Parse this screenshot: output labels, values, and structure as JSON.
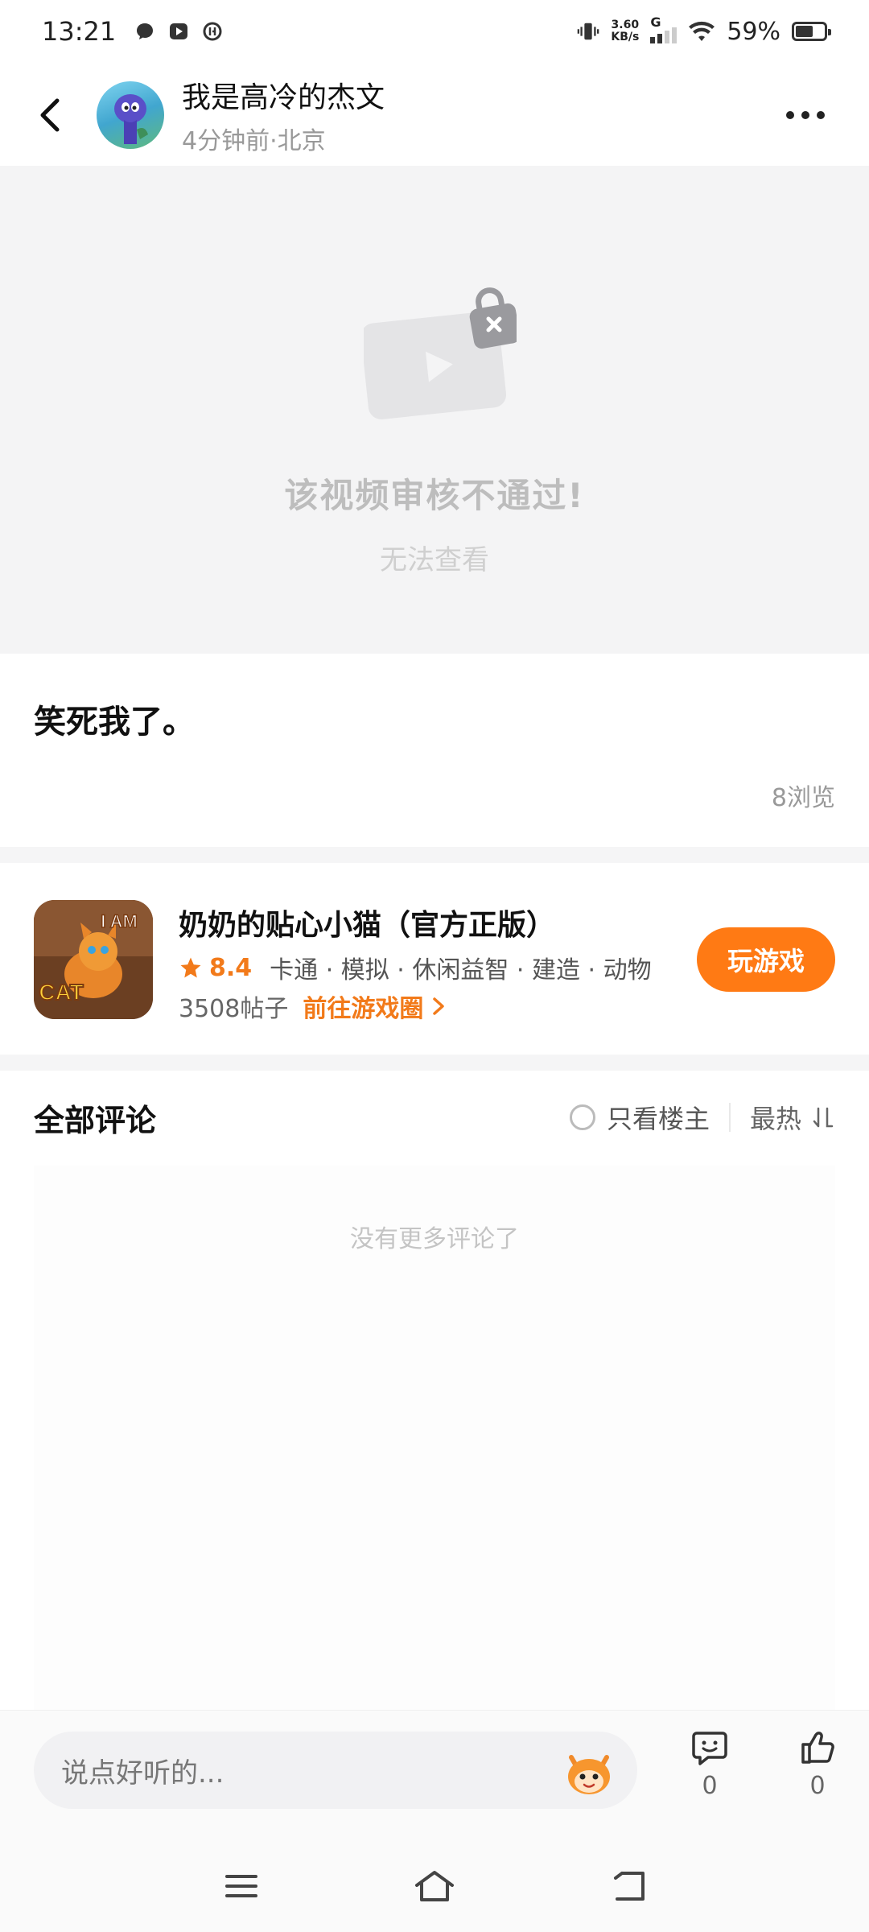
{
  "status_bar": {
    "time": "13:21",
    "net_speed_value": "3.60",
    "net_speed_unit": "KB/s",
    "network": "G",
    "battery": "59%",
    "battery_level": 0.59
  },
  "header": {
    "user_name": "我是高冷的杰文",
    "user_meta": "4分钟前·北京"
  },
  "video": {
    "blocked_title": "该视频审核不通过!",
    "blocked_subtitle": "无法查看"
  },
  "post": {
    "text": "笑死我了。",
    "views": "8浏览"
  },
  "game": {
    "title": "奶奶的贴心小猫（官方正版）",
    "score": "8.4",
    "tags": "卡通 · 模拟 · 休闲益智 · 建造 · 动物",
    "posts": "3508帖子",
    "goto_label": "前往游戏圈",
    "play_label": "玩游戏",
    "icon_text_top": "I AM",
    "icon_text_bottom": "CAT"
  },
  "comments": {
    "title": "全部评论",
    "owner_only": "只看楼主",
    "sort": "最热",
    "empty": "没有更多评论了"
  },
  "bottom_bar": {
    "placeholder": "说点好听的...",
    "comment_count": "0",
    "like_count": "0"
  },
  "colors": {
    "accent": "#ff7a14",
    "muted": "#999999"
  }
}
